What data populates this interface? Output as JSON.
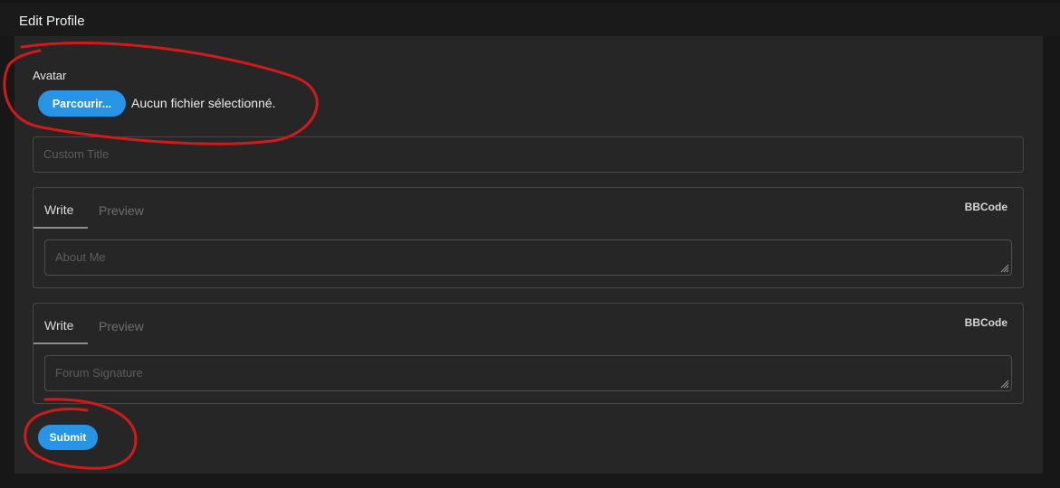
{
  "header": {
    "title": "Edit Profile"
  },
  "avatar": {
    "label": "Avatar",
    "browse_label": "Parcourir...",
    "file_status": "Aucun fichier sélectionné."
  },
  "custom_title": {
    "placeholder": "Custom Title",
    "value": ""
  },
  "about_editor": {
    "tabs": [
      {
        "label": "Write",
        "active": true
      },
      {
        "label": "Preview",
        "active": false
      }
    ],
    "mode_label": "BBCode",
    "placeholder": "About Me",
    "value": ""
  },
  "signature_editor": {
    "tabs": [
      {
        "label": "Write",
        "active": true
      },
      {
        "label": "Preview",
        "active": false
      }
    ],
    "mode_label": "BBCode",
    "placeholder": "Forum Signature",
    "value": ""
  },
  "submit": {
    "label": "Submit"
  },
  "colors": {
    "accent": "#2794e6",
    "panel_bg": "#262626",
    "page_bg": "#171717",
    "annotation": "#d11a1a"
  },
  "icons": {
    "textarea_resize": "resize-grip-icon"
  }
}
